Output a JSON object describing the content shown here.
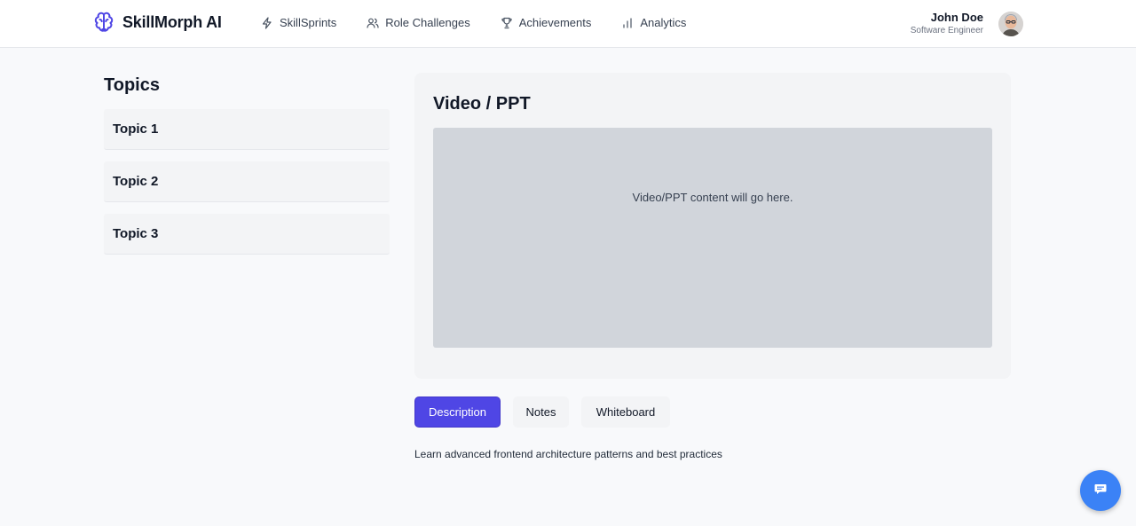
{
  "brand": {
    "name": "SkillMorph AI",
    "logo_icon": "brain-icon",
    "accent": "#4f46e5"
  },
  "nav": {
    "items": [
      {
        "label": "SkillSprints",
        "icon": "lightning-icon"
      },
      {
        "label": "Role Challenges",
        "icon": "users-icon"
      },
      {
        "label": "Achievements",
        "icon": "trophy-icon"
      },
      {
        "label": "Analytics",
        "icon": "bar-chart-icon"
      }
    ]
  },
  "user": {
    "name": "John Doe",
    "role": "Software Engineer"
  },
  "sidebar": {
    "title": "Topics",
    "items": [
      {
        "label": "Topic 1"
      },
      {
        "label": "Topic 2"
      },
      {
        "label": "Topic 3"
      }
    ]
  },
  "video": {
    "title": "Video / PPT",
    "placeholder": "Video/PPT content will go here."
  },
  "tabs": {
    "items": [
      {
        "label": "Description",
        "active": true
      },
      {
        "label": "Notes",
        "active": false
      },
      {
        "label": "Whiteboard",
        "active": false
      }
    ]
  },
  "description": {
    "text": "Learn advanced frontend architecture patterns and best practices"
  },
  "chat": {
    "icon": "chat-icon",
    "color": "#3b82f6"
  }
}
